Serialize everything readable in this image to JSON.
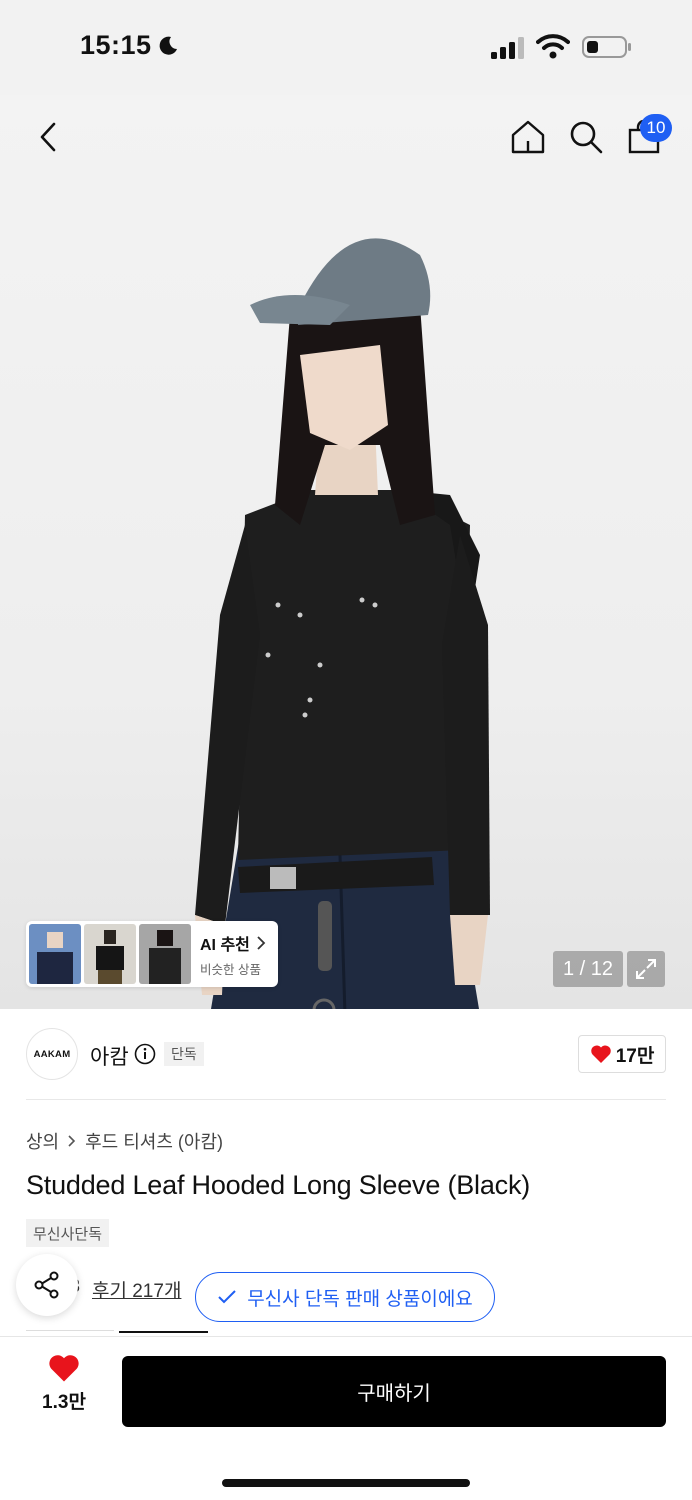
{
  "status_bar": {
    "time": "15:15",
    "icons": [
      "moon-icon",
      "cellular-signal-icon",
      "wifi-icon",
      "battery-icon"
    ]
  },
  "nav": {
    "icons": [
      "back-arrow-icon",
      "home-icon",
      "search-icon",
      "shopping-bag-icon"
    ],
    "cart_badge": "10"
  },
  "gallery": {
    "ai_recommend": {
      "title": "AI 추천",
      "subtitle": "비슷한 상품"
    },
    "page_indicator": "1 / 12"
  },
  "brand": {
    "logo_text": "AAKAM",
    "name": "아캄",
    "exclusive_tag": "단독",
    "like_count": "17만"
  },
  "product": {
    "breadcrumb": [
      "상의",
      "후드 티셔츠 (아캄)"
    ],
    "title": "Studded Leaf Hooded Long Sleeve (Black)",
    "tag": "무신사단독",
    "rating_partial": "3",
    "review_link": "후기 217개",
    "toast": "무신사 단독 판매 상품이에요"
  },
  "bottom_bar": {
    "wish_count": "1.3만",
    "buy_label": "구매하기"
  },
  "colors": {
    "accent_blue": "#1f5ff3",
    "heart_red": "#e8141c",
    "buy_black": "#000000"
  }
}
